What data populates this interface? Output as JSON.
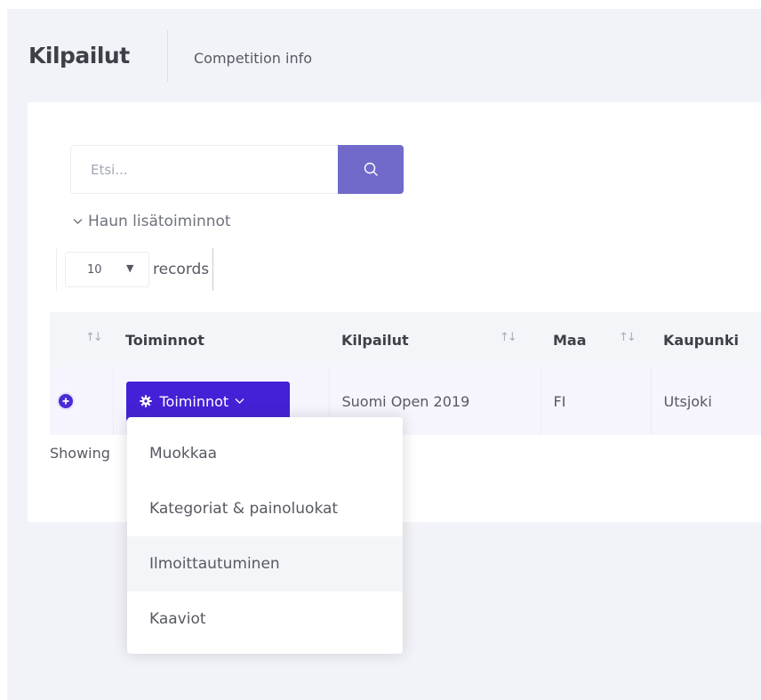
{
  "header": {
    "title": "Kilpailut",
    "breadcrumb": "Competition info"
  },
  "search": {
    "placeholder": "Etsi...",
    "button_icon": "search-icon"
  },
  "advanced_search": {
    "label": "Haun lisätoiminnot",
    "icon": "chevron-down-icon"
  },
  "records": {
    "selected": "10",
    "label": "records"
  },
  "table": {
    "columns": [
      "",
      "Toiminnot",
      "Kilpailut",
      "Maa",
      "Kaupunki"
    ],
    "rows": [
      {
        "actions_label": "Toiminnot",
        "kilpailut": "Suomi Open 2019",
        "maa": "FI",
        "kaupunki": "Utsjoki"
      }
    ]
  },
  "footer": {
    "showing": "Showing"
  },
  "actions_menu": {
    "items": [
      "Muokkaa",
      "Kategoriat & painoluokat",
      "Ilmoittautuminen",
      "Kaaviot"
    ]
  },
  "colors": {
    "accent": "#716aca",
    "primary_dark": "#4421d6",
    "background": "#f2f3f8"
  }
}
